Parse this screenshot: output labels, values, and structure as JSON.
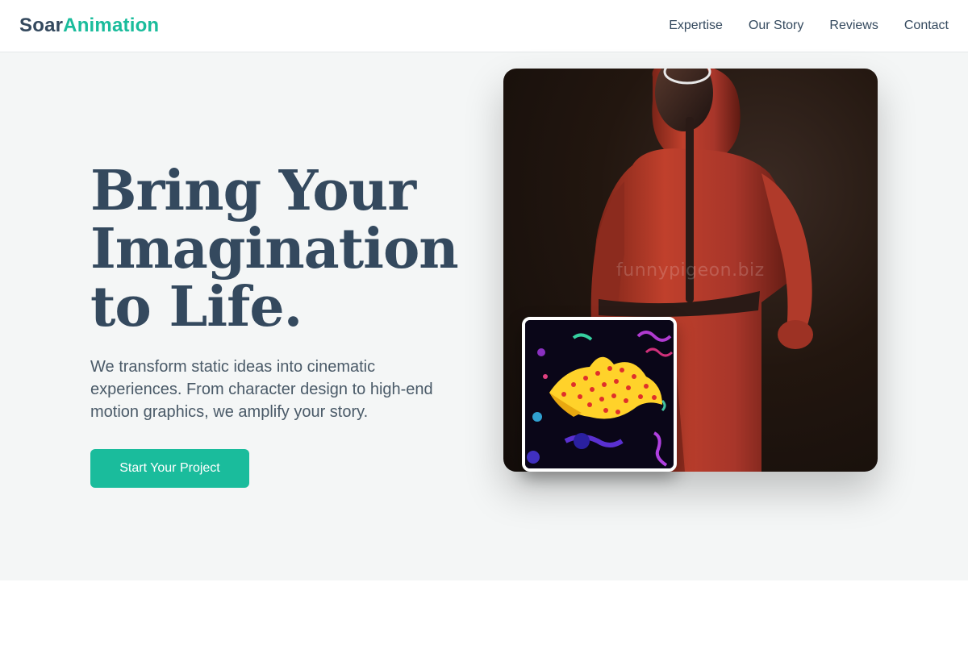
{
  "nav": {
    "brand_part1": "Soar",
    "brand_part2": "Animation",
    "links": [
      {
        "label": "Expertise"
      },
      {
        "label": "Our Story"
      },
      {
        "label": "Reviews"
      },
      {
        "label": "Contact"
      }
    ]
  },
  "hero": {
    "title_lines": [
      "Bring Your",
      "Imagination",
      "to Life."
    ],
    "subtitle": "We transform static ideas into cinematic experiences. From character design to high-end motion graphics, we amplify your story.",
    "cta_label": "Start Your Project"
  },
  "media": {
    "watermark": "funnypigeon.biz"
  },
  "colors": {
    "brand_dark": "#34495e",
    "accent": "#1abc9c",
    "hero_bg": "#f4f6f6"
  }
}
